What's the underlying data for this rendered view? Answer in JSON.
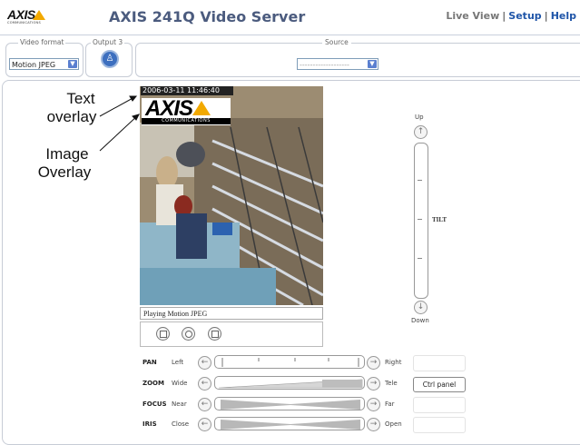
{
  "header": {
    "logo_text": "AXIS",
    "logo_sub": "COMMUNICATIONS",
    "title": "AXIS 241Q Video Server",
    "nav": {
      "live_view": "Live View",
      "sep1": "|",
      "setup": "Setup",
      "sep2": "|",
      "help": "Help"
    }
  },
  "toolbar": {
    "video_format_label": "Video format",
    "video_format_value": "Motion JPEG",
    "output_label": "Output 3",
    "source_label": "Source",
    "source_value": "-------------------"
  },
  "annotations": {
    "text_overlay_1": "Text",
    "text_overlay_2": "overlay",
    "image_overlay_1": "Image",
    "image_overlay_2": "Overlay"
  },
  "video": {
    "timestamp": "2006-03-11 11:46:40",
    "logo_text": "AXIS",
    "logo_sub": "COMMUNICATIONS",
    "status": "Playing Motion JPEG"
  },
  "tilt": {
    "up": "Up",
    "label": "TILT",
    "down": "Down"
  },
  "ptz": [
    {
      "name": "PAN",
      "left": "Left",
      "right": "Right"
    },
    {
      "name": "ZOOM",
      "left": "Wide",
      "right": "Tele"
    },
    {
      "name": "FOCUS",
      "left": "Near",
      "right": "Far"
    },
    {
      "name": "IRIS",
      "left": "Close",
      "right": "Open"
    }
  ],
  "ctrl_panel_label": "Ctrl panel"
}
